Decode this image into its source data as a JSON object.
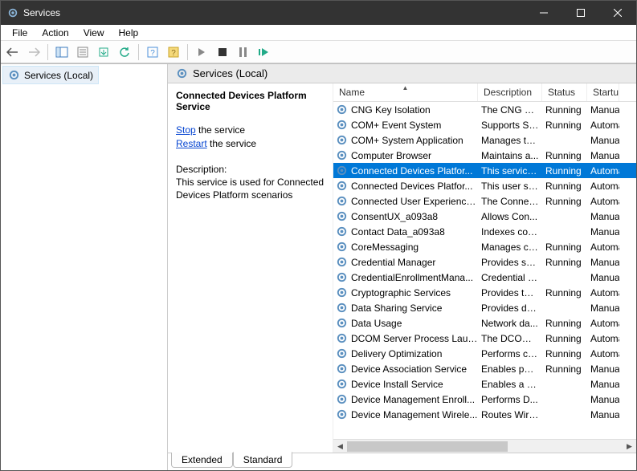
{
  "window": {
    "title": "Services"
  },
  "menubar": [
    "File",
    "Action",
    "View",
    "Help"
  ],
  "tree": {
    "root": "Services (Local)"
  },
  "pane_header": "Services (Local)",
  "detail": {
    "title": "Connected Devices Platform Service",
    "stop_link": "Stop",
    "stop_suffix": " the service",
    "restart_link": "Restart",
    "restart_suffix": " the service",
    "desc_label": "Description:",
    "desc_text": "This service is used for Connected Devices Platform scenarios"
  },
  "columns": {
    "name": "Name",
    "description": "Description",
    "status": "Status",
    "startup": "Startup Type"
  },
  "services": [
    {
      "name": "CNG Key Isolation",
      "desc": "The CNG ke...",
      "status": "Running",
      "start": "Manual"
    },
    {
      "name": "COM+ Event System",
      "desc": "Supports Sy...",
      "status": "Running",
      "start": "Automatic"
    },
    {
      "name": "COM+ System Application",
      "desc": "Manages th...",
      "status": "",
      "start": "Manual"
    },
    {
      "name": "Computer Browser",
      "desc": "Maintains a...",
      "status": "Running",
      "start": "Manual"
    },
    {
      "name": "Connected Devices Platfor...",
      "desc": "This service ...",
      "status": "Running",
      "start": "Automatic",
      "selected": true
    },
    {
      "name": "Connected Devices Platfor...",
      "desc": "This user ser...",
      "status": "Running",
      "start": "Automatic"
    },
    {
      "name": "Connected User Experience...",
      "desc": "The Connec...",
      "status": "Running",
      "start": "Automatic"
    },
    {
      "name": "ConsentUX_a093a8",
      "desc": "Allows Con...",
      "status": "",
      "start": "Manual"
    },
    {
      "name": "Contact Data_a093a8",
      "desc": "Indexes con...",
      "status": "",
      "start": "Manual"
    },
    {
      "name": "CoreMessaging",
      "desc": "Manages co...",
      "status": "Running",
      "start": "Automatic"
    },
    {
      "name": "Credential Manager",
      "desc": "Provides se...",
      "status": "Running",
      "start": "Manual"
    },
    {
      "name": "CredentialEnrollmentMana...",
      "desc": "Credential E...",
      "status": "",
      "start": "Manual"
    },
    {
      "name": "Cryptographic Services",
      "desc": "Provides thr...",
      "status": "Running",
      "start": "Automatic"
    },
    {
      "name": "Data Sharing Service",
      "desc": "Provides da...",
      "status": "",
      "start": "Manual"
    },
    {
      "name": "Data Usage",
      "desc": "Network da...",
      "status": "Running",
      "start": "Automatic"
    },
    {
      "name": "DCOM Server Process Laun...",
      "desc": "The DCOML...",
      "status": "Running",
      "start": "Automatic"
    },
    {
      "name": "Delivery Optimization",
      "desc": "Performs co...",
      "status": "Running",
      "start": "Automatic"
    },
    {
      "name": "Device Association Service",
      "desc": "Enables pair...",
      "status": "Running",
      "start": "Manual"
    },
    {
      "name": "Device Install Service",
      "desc": "Enables a c...",
      "status": "",
      "start": "Manual"
    },
    {
      "name": "Device Management Enroll...",
      "desc": "Performs D...",
      "status": "",
      "start": "Manual"
    },
    {
      "name": "Device Management Wirele...",
      "desc": "Routes Wire...",
      "status": "",
      "start": "Manual"
    }
  ],
  "tabs": {
    "extended": "Extended",
    "standard": "Standard"
  }
}
